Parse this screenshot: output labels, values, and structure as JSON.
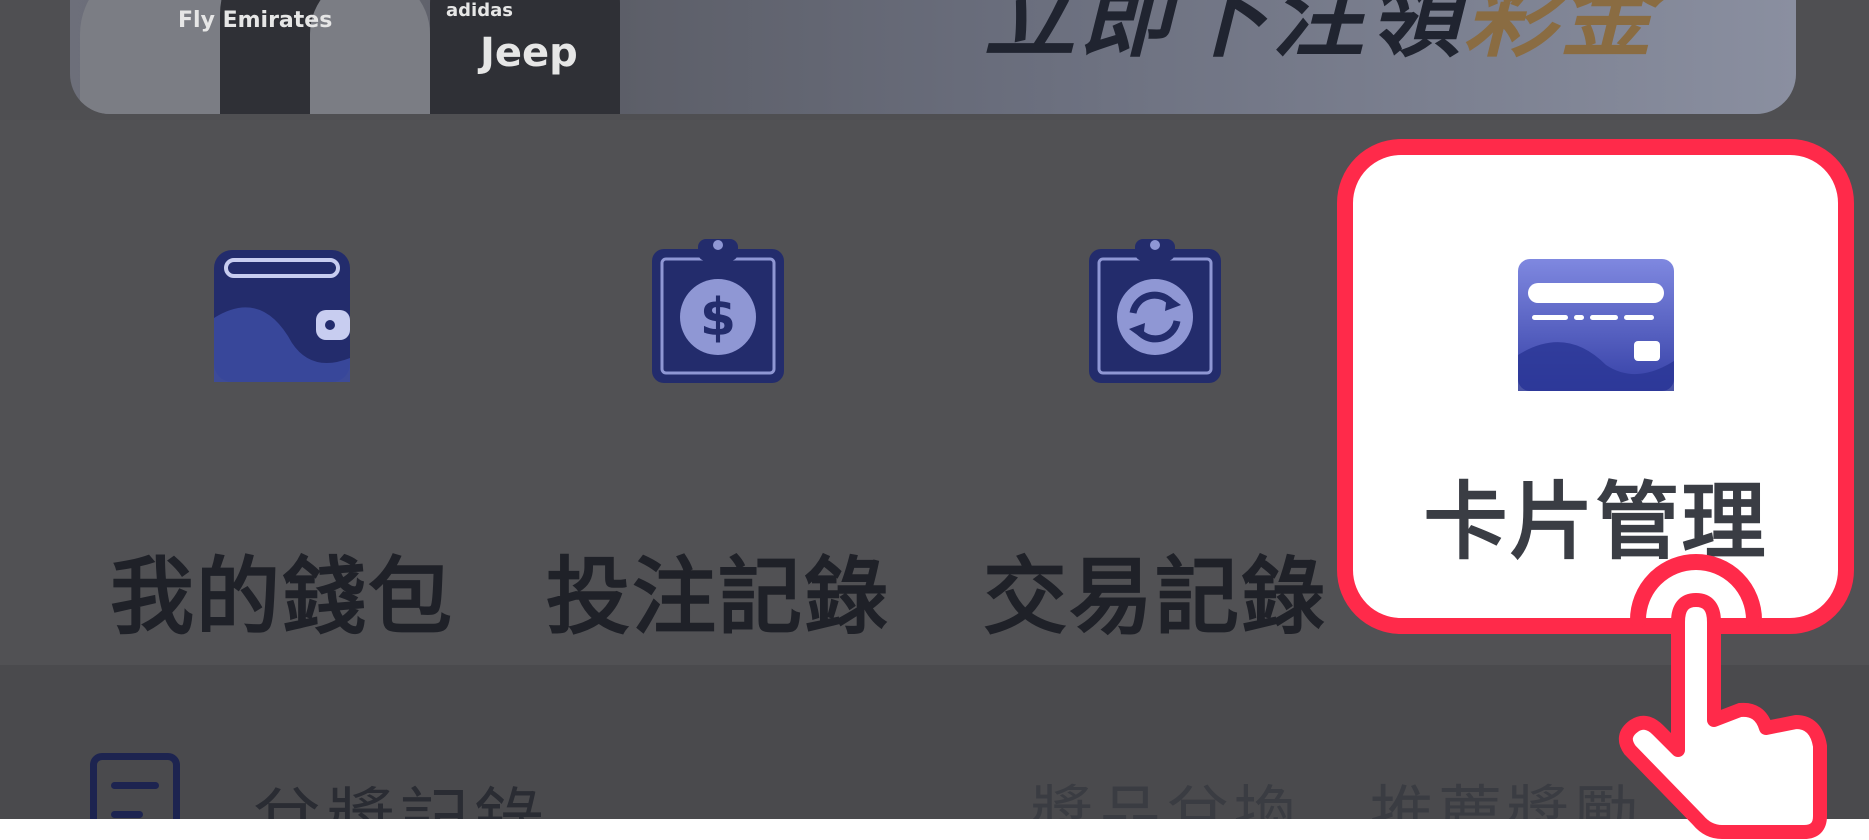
{
  "banner": {
    "headline_part1": "立即下注領",
    "headline_part2": "彩金",
    "brands": [
      "Fly Emirates",
      "adidas",
      "Jeep"
    ],
    "accent_color": "#8a6c42"
  },
  "menu": {
    "items": [
      {
        "label": "我的錢包",
        "icon": "wallet-icon"
      },
      {
        "label": "投注記錄",
        "icon": "clipboard-dollar-icon"
      },
      {
        "label": "交易記錄",
        "icon": "clipboard-refresh-icon"
      },
      {
        "label": "卡片管理",
        "icon": "credit-card-icon"
      }
    ]
  },
  "list": {
    "row": {
      "title": "兌獎記錄",
      "description": "獎品兌換、推薦獎勵",
      "icon": "document-icon"
    }
  },
  "colors": {
    "highlight": "#ff2a4a",
    "icon_navy": "#1d2450",
    "card_icon": "#5a64c8"
  },
  "pointer": {
    "icon": "pointing-hand-icon"
  }
}
